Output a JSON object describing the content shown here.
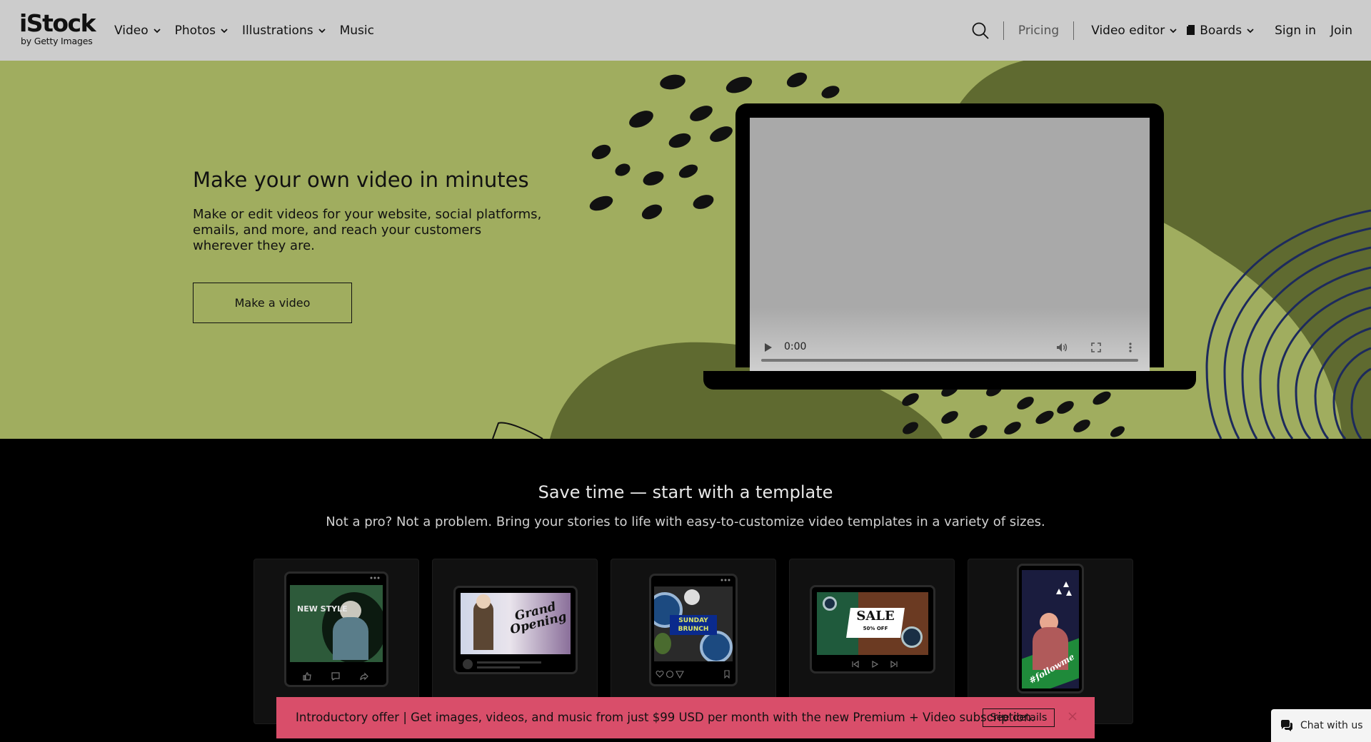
{
  "header": {
    "logo": {
      "main": "iStock",
      "sub": "by Getty Images"
    },
    "nav_left": [
      {
        "label": "Video",
        "dropdown": true
      },
      {
        "label": "Photos",
        "dropdown": true
      },
      {
        "label": "Illustrations",
        "dropdown": true
      },
      {
        "label": "Music",
        "dropdown": false
      }
    ],
    "pricing": "Pricing",
    "video_editor": "Video editor",
    "boards": "Boards",
    "sign_in": "Sign in",
    "join": "Join"
  },
  "hero": {
    "title": "Make your own video in minutes",
    "description": "Make or edit videos for your website, social platforms, emails, and more, and reach your customers wherever they are.",
    "button": "Make a video",
    "video": {
      "time": "0:00"
    },
    "colors": {
      "background": "#a0ad5f",
      "dark_shape": "#5f6a30"
    }
  },
  "templates": {
    "title": "Save time — start with a template",
    "subtitle": "Not a pro? Not a problem. Bring your stories to life with easy-to-customize video templates in a variety of sizes.",
    "cards": [
      {
        "thumb_text": "NEW STYLE",
        "icons": [
          "thumbs-up-icon",
          "comment-icon",
          "share-icon"
        ]
      },
      {
        "thumb_text": "Grand Opening"
      },
      {
        "thumb_text": "SUNDAY BRUNCH",
        "icons": [
          "heart-icon",
          "comment-icon",
          "send-icon",
          "bookmark-icon"
        ]
      },
      {
        "thumb_text": "SALE",
        "thumb_subtext": "50% OFF",
        "icons": [
          "prev-icon",
          "play-icon",
          "next-icon"
        ]
      },
      {
        "thumb_text": "#followme"
      }
    ]
  },
  "promo": {
    "text": "Introductory offer | Get images, videos, and music from just $99 USD per month with the new Premium + Video subscription.",
    "button": "See details",
    "color": "#d94e6a"
  },
  "chat": {
    "label": "Chat with us"
  }
}
